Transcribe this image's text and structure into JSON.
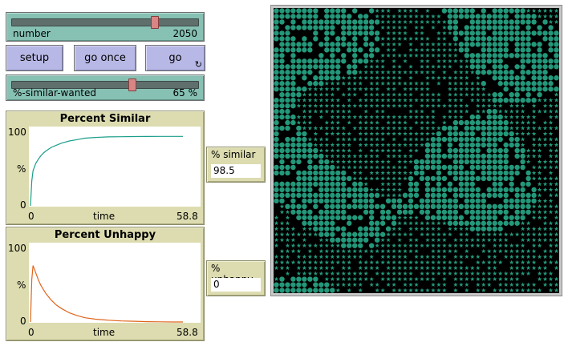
{
  "sliders": [
    {
      "label": "number",
      "value_text": "2050",
      "min": 500,
      "max": 2500,
      "value": 2050
    },
    {
      "label": "%-similar-wanted",
      "value_text": "65 %",
      "min": 0,
      "max": 100,
      "value": 65
    }
  ],
  "buttons": {
    "setup": "setup",
    "go_once": "go once",
    "go": "go",
    "forever_icon": "↻"
  },
  "plot_similar": {
    "title": "Percent Similar",
    "y_max": "100",
    "y_min": "0",
    "y_label": "%",
    "x_min": "0",
    "x_label": "time",
    "x_max": "58.8",
    "color": "#1a9e8a"
  },
  "plot_unhappy": {
    "title": "Percent Unhappy",
    "y_max": "100",
    "y_min": "0",
    "y_label": "%",
    "x_min": "0",
    "x_label": "time",
    "x_max": "58.8",
    "color": "#e0641c"
  },
  "monitors": {
    "similar": {
      "label": "% similar",
      "value": "98.5"
    },
    "unhappy": {
      "label": "% unhappy",
      "value": "0"
    }
  },
  "chart_data": [
    {
      "type": "line",
      "title": "Percent Similar",
      "xlabel": "time",
      "ylabel": "%",
      "xlim": [
        0,
        58.8
      ],
      "ylim": [
        0,
        100
      ],
      "series": [
        {
          "x": [
            0,
            0.5,
            1,
            2,
            3,
            4,
            5,
            6,
            8,
            10,
            12,
            15,
            18,
            21,
            25,
            30,
            35,
            40,
            45,
            50,
            55,
            58.8
          ],
          "values": [
            0,
            35,
            50,
            60,
            66,
            71,
            75,
            78,
            83,
            86,
            89,
            92,
            94,
            96,
            97,
            97.8,
            98.1,
            98.3,
            98.4,
            98.5,
            98.5,
            98.5
          ]
        }
      ]
    },
    {
      "type": "line",
      "title": "Percent Unhappy",
      "xlabel": "time",
      "ylabel": "%",
      "xlim": [
        0,
        58.8
      ],
      "ylim": [
        0,
        100
      ],
      "series": [
        {
          "x": [
            0,
            0.5,
            1,
            2,
            3,
            4,
            6,
            8,
            10,
            12,
            15,
            18,
            21,
            25,
            30,
            35,
            40,
            45,
            50,
            55,
            58.8
          ],
          "values": [
            0,
            60,
            80,
            70,
            60,
            52,
            40,
            31,
            24,
            19,
            13,
            9,
            6,
            4,
            2.5,
            1.5,
            1,
            0.5,
            0.2,
            0,
            0
          ]
        }
      ]
    }
  ],
  "world": {
    "background": "#000000",
    "turtle_color": "#23987a",
    "star_color": "#23987a",
    "grid_size": 51
  }
}
